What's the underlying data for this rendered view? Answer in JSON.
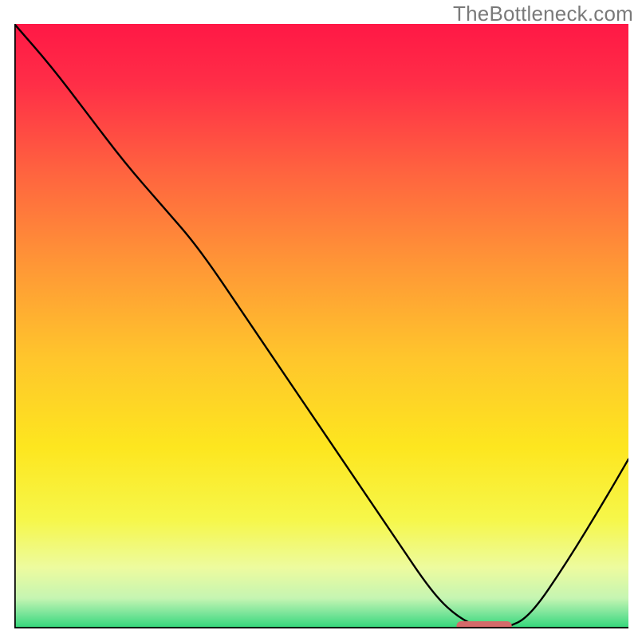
{
  "watermark": "TheBottleneck.com",
  "chart_data": {
    "type": "line",
    "title": "",
    "xlabel": "",
    "ylabel": "",
    "xlim": [
      0,
      100
    ],
    "ylim": [
      0,
      100
    ],
    "x": [
      0,
      6,
      12,
      18,
      24,
      30,
      38,
      46,
      54,
      62,
      68,
      72,
      76,
      80,
      84,
      90,
      96,
      100
    ],
    "values": [
      100,
      93,
      85,
      77,
      70,
      63,
      51,
      39,
      27,
      15,
      6,
      2,
      0,
      0,
      2,
      11,
      21,
      28
    ],
    "marker": {
      "x_start": 72,
      "x_end": 81,
      "y": 0
    },
    "gradient_stops": [
      {
        "offset": 0.0,
        "color": "#ff1846"
      },
      {
        "offset": 0.1,
        "color": "#ff2e47"
      },
      {
        "offset": 0.25,
        "color": "#ff653f"
      },
      {
        "offset": 0.4,
        "color": "#ff9736"
      },
      {
        "offset": 0.55,
        "color": "#ffc52c"
      },
      {
        "offset": 0.7,
        "color": "#fde61f"
      },
      {
        "offset": 0.82,
        "color": "#f6f74a"
      },
      {
        "offset": 0.9,
        "color": "#edfb9f"
      },
      {
        "offset": 0.95,
        "color": "#c5f5b2"
      },
      {
        "offset": 0.975,
        "color": "#7be59a"
      },
      {
        "offset": 1.0,
        "color": "#2fd679"
      }
    ],
    "axes_color": "#000000",
    "curve_color": "#000000",
    "marker_color": "#d46a6a"
  }
}
